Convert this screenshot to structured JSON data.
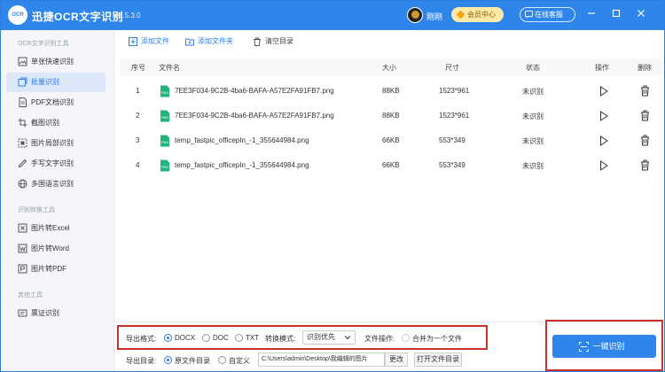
{
  "app": {
    "logo_text": "OCR",
    "title": "迅捷OCR文字识别",
    "version": "v8.5.3.0",
    "username": "刚刚",
    "vip_label": "会员中心",
    "support_label": "在线客服",
    "window_controls": [
      "minimize-icon",
      "maximize-icon",
      "close-icon"
    ]
  },
  "sidebar": {
    "sections": [
      {
        "title": "OCR文字识别工具",
        "items": [
          {
            "label": "单张快速识别",
            "icon": "single-image-icon",
            "active": false
          },
          {
            "label": "批量识别",
            "icon": "batch-icon",
            "active": true
          },
          {
            "label": "PDF文档识别",
            "icon": "pdf-icon",
            "active": false
          },
          {
            "label": "截图识别",
            "icon": "screenshot-icon",
            "active": false
          },
          {
            "label": "图片局部识别",
            "icon": "partial-image-icon",
            "active": false
          },
          {
            "label": "手写文字识别",
            "icon": "handwriting-icon",
            "active": false
          },
          {
            "label": "多国语言识别",
            "icon": "globe-icon",
            "active": false
          }
        ]
      },
      {
        "title": "识别转换工具",
        "items": [
          {
            "label": "图片转Excel",
            "icon": "excel-icon",
            "active": false
          },
          {
            "label": "图片转Word",
            "icon": "word-icon",
            "active": false
          },
          {
            "label": "图片转PDF",
            "icon": "pdf-convert-icon",
            "active": false
          }
        ]
      },
      {
        "title": "其他工具",
        "items": [
          {
            "label": "票证识别",
            "icon": "ticket-icon",
            "active": false
          }
        ]
      }
    ]
  },
  "toolbar": {
    "add_file": "添加文件",
    "add_folder": "添加文件夹",
    "clear_list": "清空目录"
  },
  "table": {
    "columns": {
      "index": "序号",
      "filename": "文件名",
      "size": "大小",
      "dimensions": "尺寸",
      "status": "状态",
      "action": "操作",
      "delete": "删除"
    },
    "rows": [
      {
        "index": "1",
        "filename": "7EE3F034-9C2B-4ba6-BAFA-A57E2FA91FB7.png",
        "size": "88KB",
        "dimensions": "1523*961",
        "status": "未识别"
      },
      {
        "index": "2",
        "filename": "7EE3F034-9C2B-4ba6-BAFA-A57E2FA91FB7.png",
        "size": "88KB",
        "dimensions": "1523*961",
        "status": "未识别"
      },
      {
        "index": "3",
        "filename": "temp_fastpic_officepIn_-1_355644984.png",
        "size": "66KB",
        "dimensions": "553*349",
        "status": "未识别"
      },
      {
        "index": "4",
        "filename": "temp_fastpic_officepIn_-1_355644984.png",
        "size": "66KB",
        "dimensions": "553*349",
        "status": "未识别"
      }
    ],
    "file_badge": "PNG"
  },
  "bottom": {
    "output_format_label": "导出格式:",
    "formats": [
      {
        "label": "DOCX",
        "checked": true
      },
      {
        "label": "DOC",
        "checked": false
      },
      {
        "label": "TXT",
        "checked": false
      }
    ],
    "convert_mode_label": "转换模式:",
    "convert_mode_value": "识别优先",
    "file_op_label": "文件操作:",
    "merge_label": "合并为一个文件",
    "output_dir_label": "导出目录:",
    "dir_options": [
      {
        "label": "原文件目录",
        "checked": true
      },
      {
        "label": "自定义",
        "checked": false
      }
    ],
    "path_value": "C:\\Users\\admin\\Desktop\\我编辑的图片",
    "change_button": "更改",
    "open_dir_button": "打开文件目录",
    "start_button": "一键识别"
  },
  "colors": {
    "brand": "#2f86ea",
    "highlight_box": "#c9312b",
    "active_nav_bg": "#dce8f9"
  }
}
